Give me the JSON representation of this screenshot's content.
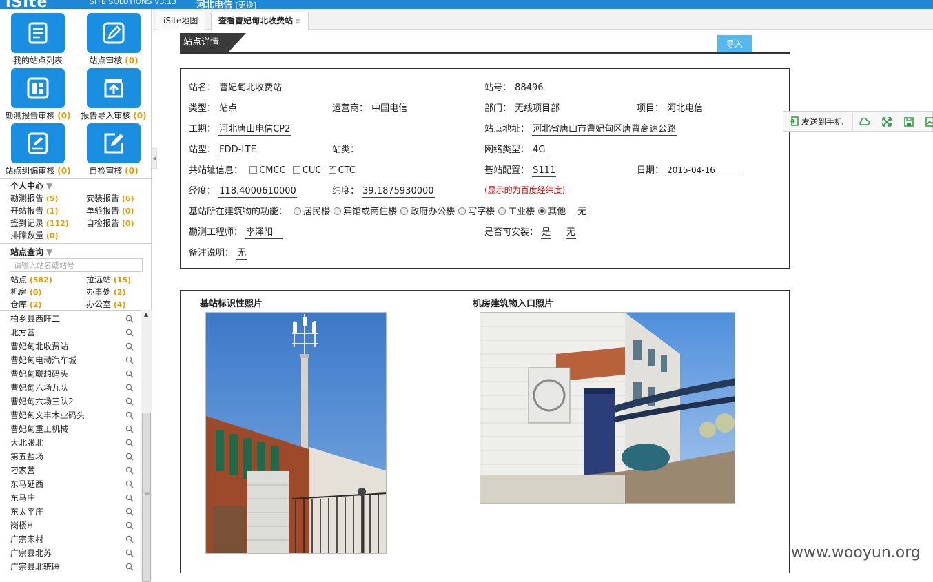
{
  "topbar": {
    "logo": "iSite",
    "version": "SITE SOLUTIONS V3.13",
    "org": "河北电信",
    "switch": "[更换]"
  },
  "tiles": [
    {
      "label": "我的站点列表",
      "count": ""
    },
    {
      "label": "站点审核",
      "count": "(0)"
    },
    {
      "label": "勘测报告审核",
      "count": "(0)"
    },
    {
      "label": "报告导入审核",
      "count": "(0)"
    },
    {
      "label": "站点纠偏审核",
      "count": "(0)"
    },
    {
      "label": "自检审核",
      "count": "(0)"
    }
  ],
  "personal": {
    "title": "个人中心",
    "items": [
      {
        "label": "勘测报告",
        "count": "(5)"
      },
      {
        "label": "安装报告",
        "count": "(6)"
      },
      {
        "label": "开站报告",
        "count": "(1)"
      },
      {
        "label": "单验报告",
        "count": "(0)"
      },
      {
        "label": "签到记录",
        "count": "(112)"
      },
      {
        "label": "自检报告",
        "count": "(0)"
      },
      {
        "label": "排障数量",
        "count": "(0)"
      }
    ]
  },
  "site_query": {
    "title": "站点查询",
    "placeholder": "请输入站名或站号",
    "items": [
      {
        "label": "站点",
        "count": "(582)"
      },
      {
        "label": "拉远站",
        "count": "(15)"
      },
      {
        "label": "机房",
        "count": "(0)"
      },
      {
        "label": "办事处",
        "count": "(2)"
      },
      {
        "label": "仓库",
        "count": "(2)"
      },
      {
        "label": "办公室",
        "count": "(4)"
      }
    ]
  },
  "site_list": [
    "柏乡县西旺二",
    "北方营",
    "曹妃甸北收费站",
    "曹妃甸电动汽车城",
    "曹妃甸联想码头",
    "曹妃甸六场九队",
    "曹妃甸六场三队2",
    "曹妃甸文丰木业码头",
    "曹妃甸重工机械",
    "大北张北",
    "第五盐场",
    "刁家营",
    "东马延西",
    "东马庄",
    "东太平庄",
    "岗楼H",
    "广宗宋村",
    "广宗县北苏",
    "广宗县北辘睡"
  ],
  "tabs": [
    {
      "label": "iSite地图"
    },
    {
      "label": "查看曹妃甸北收费站",
      "close": "⊠"
    }
  ],
  "section": {
    "title": "站点详情",
    "import_label": "导入"
  },
  "detail": {
    "name_label": "站名：",
    "name": "曹妃甸北收费站",
    "no_label": "站号：",
    "no": "88496",
    "type_label": "类型：",
    "type": "站点",
    "operator_label": "运营商：",
    "operator": "中国电信",
    "dept_label": "部门：",
    "dept": "无线项目部",
    "project_label": "项目：",
    "project": "河北电信",
    "phase_label": "工期：",
    "phase": "河北唐山电信CP2",
    "addr_label": "站点地址：",
    "addr": "河北省唐山市曹妃甸区唐曹高速公路",
    "stype_label": "站型：",
    "stype": "FDD-LTE",
    "sclass_label": "站类：",
    "net_label": "网络类型：",
    "net": "4G",
    "share_label": "共站址信息：",
    "cmcc": "CMCC",
    "cuc": "CUC",
    "ctc": "CTC",
    "config_label": "基站配置：",
    "config": "S111",
    "date_label": "日期：",
    "date": "2015-04-16",
    "lon_label": "经度：",
    "lon": "118.4000610000",
    "lat_label": "纬度：",
    "lat": "39.1875930000",
    "coord_note": "(显示的为百度经纬度)",
    "func_label": "基站所在建筑物的功能：",
    "func_options": [
      "居民楼",
      "宾馆或商住楼",
      "政府办公楼",
      "写字楼",
      "工业楼",
      "其他"
    ],
    "func_other": "无",
    "engineer_label": "勘测工程师：",
    "engineer": "李泽阳",
    "install_label": "是否可安装：",
    "install": "是",
    "install_note": "无",
    "remark_label": "备注说明：",
    "remark": "无"
  },
  "float_tools": {
    "send_label": "发送到手机"
  },
  "photos": {
    "left_title": "基站标识性照片",
    "right_title": "机房建筑物入口照片"
  },
  "watermark": "www.wooyun.org",
  "colors": {
    "accent": "#1a8ee0",
    "count": "#e59a00",
    "note": "#cc0000"
  }
}
